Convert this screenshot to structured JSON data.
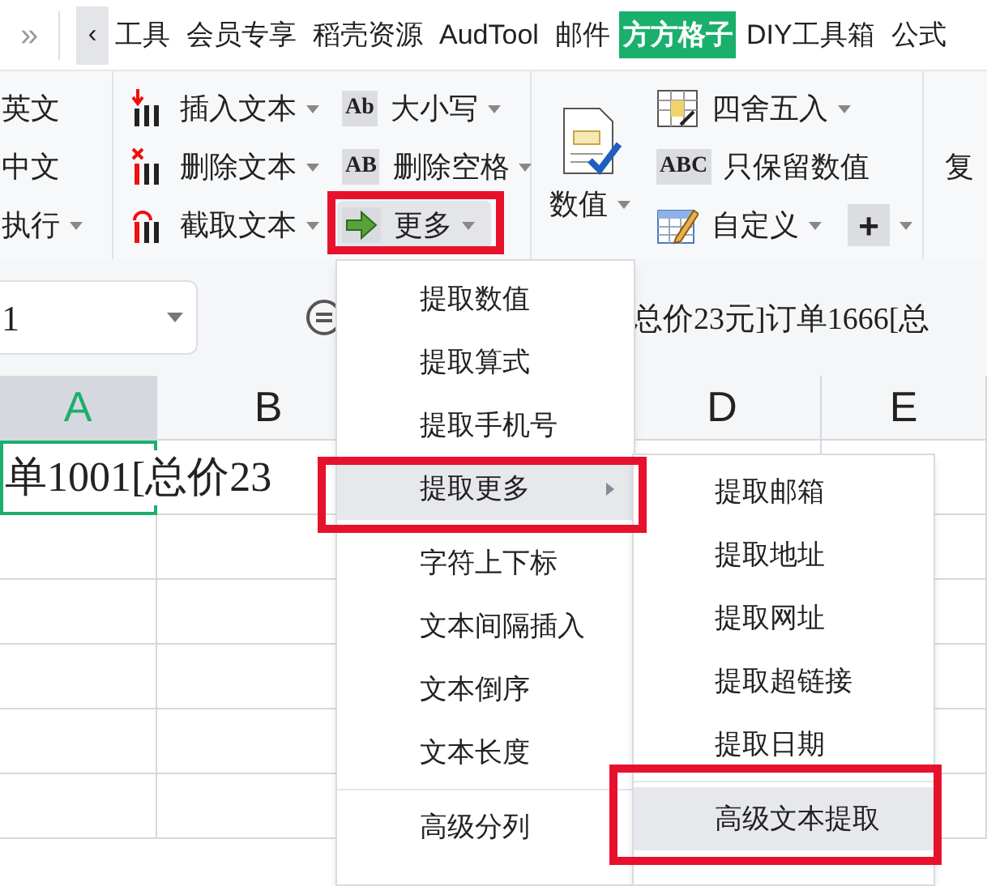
{
  "top_bar": {
    "overflow": "»",
    "scroll_left": "‹",
    "tabs": [
      {
        "label": "工具",
        "selected": false
      },
      {
        "label": "会员专享",
        "selected": false
      },
      {
        "label": "稻壳资源",
        "selected": false
      },
      {
        "label": "AudTool",
        "selected": false
      },
      {
        "label": "邮件",
        "selected": false
      },
      {
        "label": "方方格子",
        "selected": true
      },
      {
        "label": "DIY工具箱",
        "selected": false
      },
      {
        "label": "公式",
        "selected": false
      }
    ]
  },
  "ribbon": {
    "groups": [
      {
        "kind": "small",
        "rows": [
          [
            {
              "label": "英文",
              "dropdown": false,
              "highlighted": false,
              "annotated": false
            }
          ],
          [
            {
              "label": "中文",
              "dropdown": false,
              "highlighted": false,
              "annotated": false
            }
          ],
          [
            {
              "label": "执行",
              "dropdown": true,
              "highlighted": false,
              "annotated": false
            }
          ]
        ]
      },
      {
        "kind": "small",
        "rows": [
          [
            {
              "label": "插入文本",
              "dropdown": true,
              "highlighted": false,
              "annotated": false
            }
          ],
          [
            {
              "label": "删除文本",
              "dropdown": true,
              "highlighted": false,
              "annotated": false
            }
          ],
          [
            {
              "label": "截取文本",
              "dropdown": true,
              "highlighted": false,
              "annotated": false
            }
          ]
        ]
      },
      {
        "kind": "small",
        "rows": [
          [
            {
              "label": "大小写",
              "icon_text": "Ab",
              "dropdown": true,
              "highlighted": false,
              "annotated": false
            }
          ],
          [
            {
              "label": "删除空格",
              "icon_text": "AB",
              "dropdown": true,
              "highlighted": false,
              "annotated": false
            }
          ],
          [
            {
              "label": "更多",
              "dropdown": true,
              "highlighted": true,
              "annotated": true
            }
          ]
        ]
      },
      {
        "kind": "large",
        "rows": [
          [
            {
              "label": "数值",
              "dropdown": true,
              "highlighted": false,
              "annotated": false
            }
          ]
        ]
      },
      {
        "kind": "small",
        "rows": [
          [
            {
              "label": "四舍五入",
              "dropdown": true,
              "highlighted": false,
              "annotated": false
            }
          ],
          [
            {
              "label": "只保留数值",
              "icon_text": "ABC",
              "dropdown": false,
              "highlighted": false,
              "annotated": false
            }
          ],
          [
            {
              "label": "自定义",
              "dropdown": true,
              "highlighted": false,
              "annotated": false
            },
            {
              "label": "+",
              "dropdown": true,
              "highlighted": false,
              "annotated": false
            }
          ]
        ]
      },
      {
        "kind": "small",
        "rows": [
          [],
          [
            {
              "label": "复",
              "dropdown": false,
              "highlighted": false,
              "annotated": false
            }
          ],
          []
        ]
      }
    ]
  },
  "name_box": {
    "value": "1"
  },
  "formula_bar": {
    "text": "总价23元]订单1666[总"
  },
  "columns": [
    {
      "label": "A",
      "selected": true
    },
    {
      "label": "B",
      "selected": false
    },
    {
      "label": "D",
      "selected": false
    },
    {
      "label": "E",
      "selected": false
    }
  ],
  "cell": {
    "text": "单1001[总价23",
    "selected": true
  },
  "menu": {
    "sections": [
      [
        {
          "label": "提取数值",
          "submenu": false,
          "selected": false,
          "annotated": false
        },
        {
          "label": "提取算式",
          "submenu": false,
          "selected": false,
          "annotated": false
        },
        {
          "label": "提取手机号",
          "submenu": false,
          "selected": false,
          "annotated": false
        },
        {
          "label": "提取更多",
          "submenu": true,
          "selected": true,
          "annotated": true
        }
      ],
      [
        {
          "label": "字符上下标",
          "submenu": false,
          "selected": false,
          "annotated": false
        },
        {
          "label": "文本间隔插入",
          "submenu": false,
          "selected": false,
          "annotated": false
        },
        {
          "label": "文本倒序",
          "submenu": false,
          "selected": false,
          "annotated": false
        },
        {
          "label": "文本长度",
          "submenu": false,
          "selected": false,
          "annotated": false
        }
      ],
      [
        {
          "label": "高级分列",
          "submenu": false,
          "selected": false,
          "annotated": false
        }
      ]
    ]
  },
  "submenu": {
    "sections": [
      [
        {
          "label": "提取邮箱",
          "selected": false,
          "annotated": false
        },
        {
          "label": "提取地址",
          "selected": false,
          "annotated": false
        },
        {
          "label": "提取网址",
          "selected": false,
          "annotated": false
        },
        {
          "label": "提取超链接",
          "selected": false,
          "annotated": false
        },
        {
          "label": "提取日期",
          "selected": false,
          "annotated": false
        }
      ],
      [
        {
          "label": "高级文本提取",
          "selected": true,
          "annotated": true
        }
      ]
    ]
  }
}
